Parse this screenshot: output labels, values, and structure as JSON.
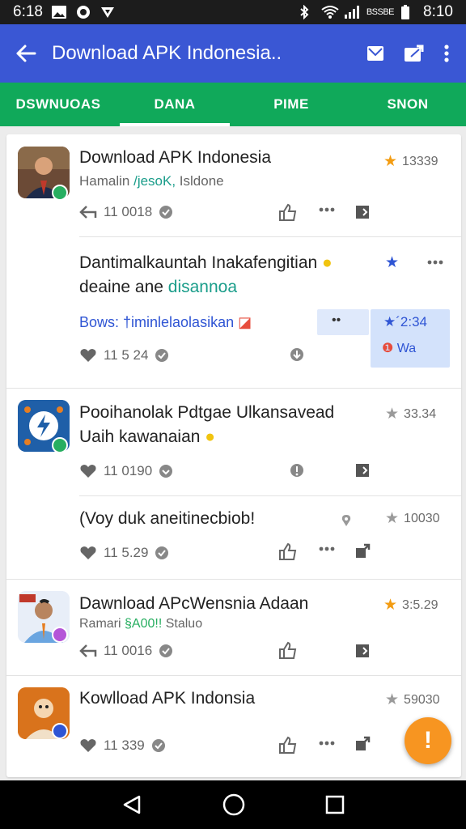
{
  "status_bar": {
    "time_left": "6:18",
    "carrier_small": "BSSBE",
    "time_right": "8:10"
  },
  "app_bar": {
    "title": "Download APK Indonesia.."
  },
  "tabs": [
    {
      "label": "DSWNUOAS",
      "active": false
    },
    {
      "label": "DANA",
      "active": true
    },
    {
      "label": "PIME",
      "active": false
    },
    {
      "label": "SNON",
      "active": false
    }
  ],
  "items": [
    {
      "title": "Download APK Indonesia",
      "sub_a": "Hamalin ",
      "sub_b": "/jesoK,",
      "sub_c": " Isldone",
      "rating": "13339",
      "count": "11 0018",
      "star_color": "#f39c12"
    },
    {
      "title": "Dantimalkauntah Inakafengitian",
      "title2_a": "deaine ane ",
      "title2_b": "disannoa",
      "link": "Bows: †iminlelaolasikan",
      "count": "11 5 24",
      "popup_dots": "••",
      "popup_time": "´2:34",
      "popup_label": "Wa"
    },
    {
      "title": "Pooihanolak Pdtgae Ulkansavead",
      "title2": "Uaih kawanaian",
      "rating": "33.34",
      "count": "11 0190"
    },
    {
      "title": "(Voy duk aneitinecbiob!",
      "rating": "10030",
      "count": "11 5.29"
    },
    {
      "title": "Dawnload APcWensnia Adaan",
      "sub_a": "Ramari ",
      "sub_b": "§A00!!",
      "sub_c": " Staluo",
      "rating": "3:5.29",
      "count": "11 0016",
      "star_color": "#f39c12"
    },
    {
      "title": "Kowlload APK Indonsia",
      "rating": "59030",
      "count": "11 339"
    }
  ],
  "fab": {
    "label": "!"
  },
  "colors": {
    "app_bar": "#3a57d4",
    "tabs": "#10a95a",
    "fab": "#f79521",
    "star_orange": "#f39c12",
    "star_blue": "#2f55d4",
    "star_grey": "#9a9a9a"
  }
}
